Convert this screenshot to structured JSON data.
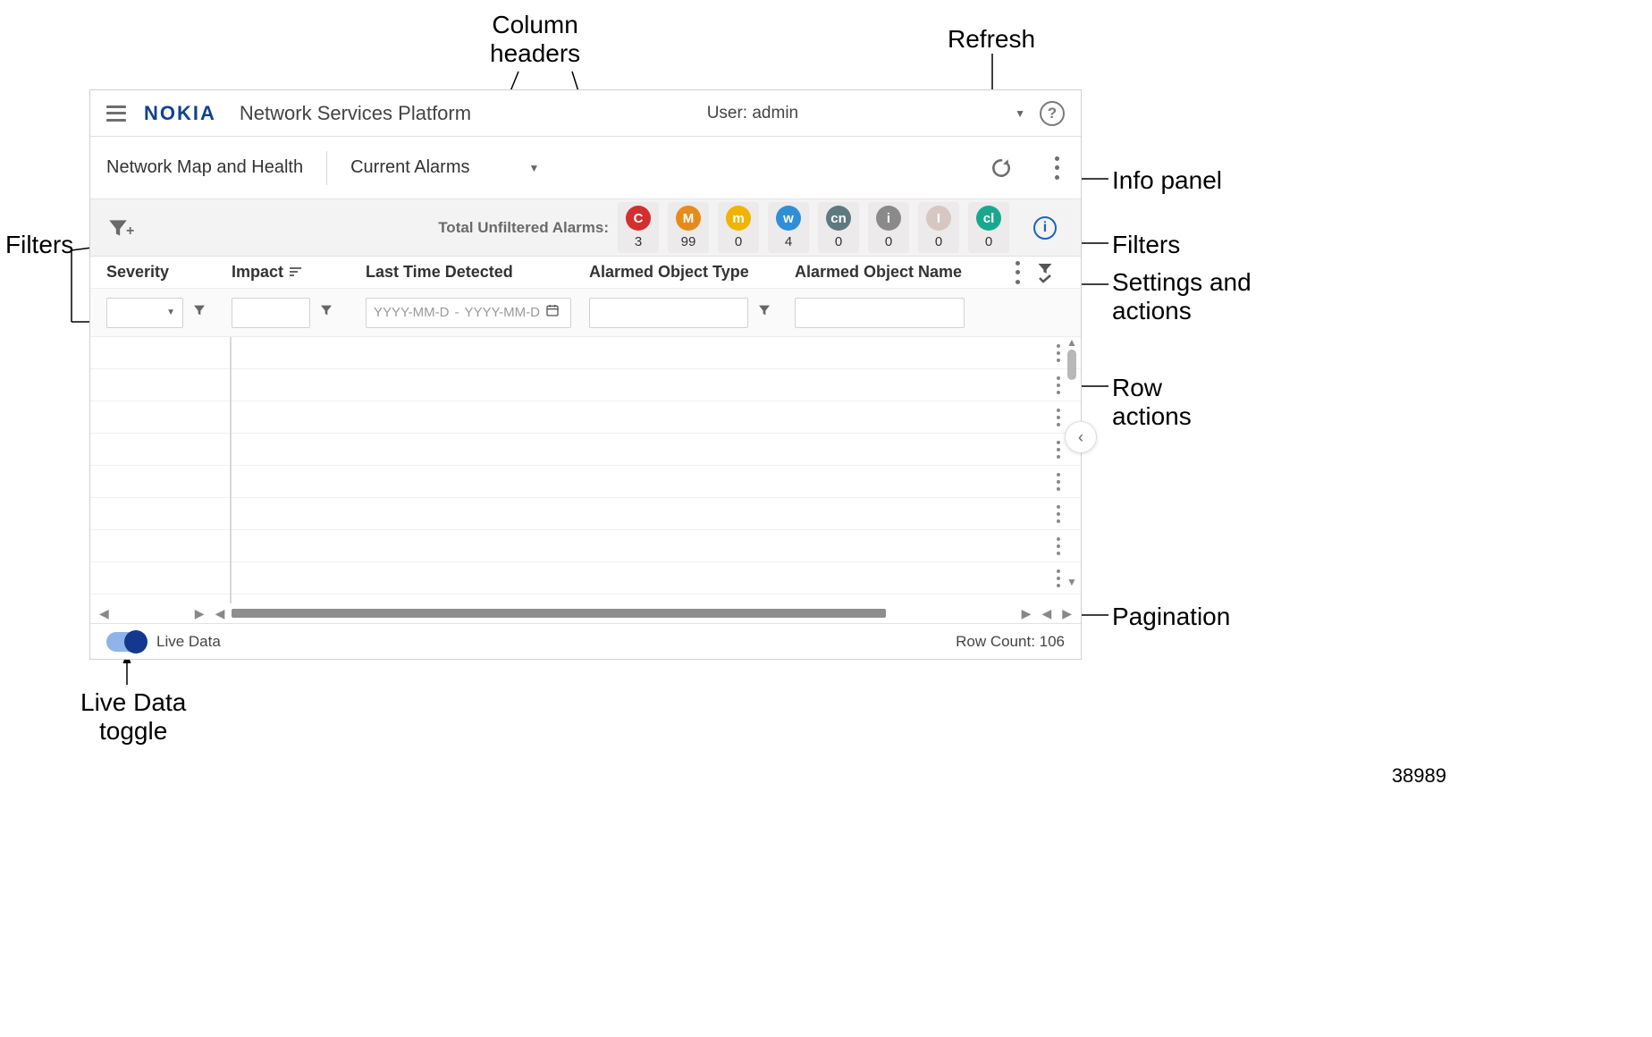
{
  "annotations": {
    "col_headers": "Column\nheaders",
    "refresh": "Refresh",
    "info_panel": "Info panel",
    "filters_left": "Filters",
    "filters_right": "Filters",
    "settings_actions": "Settings and\nactions",
    "row_actions": "Row\nactions",
    "pagination": "Pagination",
    "live_data_toggle": "Live Data\ntoggle",
    "image_id": "38989"
  },
  "header": {
    "brand": "NOKIA",
    "product": "Network Services Platform",
    "user_label": "User: admin"
  },
  "subnav": {
    "section": "Network Map and Health",
    "view": "Current Alarms"
  },
  "summary": {
    "total_label": "Total Unfiltered Alarms:",
    "chips": [
      {
        "code": "C",
        "color": "#d22f2f",
        "count": "3"
      },
      {
        "code": "M",
        "color": "#e88a1a",
        "count": "99"
      },
      {
        "code": "m",
        "color": "#f0b400",
        "count": "0"
      },
      {
        "code": "w",
        "color": "#2e8fd6",
        "count": "4"
      },
      {
        "code": "cn",
        "color": "#5e7a80",
        "count": "0"
      },
      {
        "code": "i",
        "color": "#8a8a8a",
        "count": "0"
      },
      {
        "code": "I",
        "color": "#d8c6c0",
        "count": "0"
      },
      {
        "code": "cl",
        "color": "#17a98f",
        "count": "0"
      }
    ]
  },
  "columns": {
    "severity": "Severity",
    "impact": "Impact",
    "last_time": "Last Time Detected",
    "obj_type": "Alarmed Object Type",
    "obj_name": "Alarmed Object Name"
  },
  "filters": {
    "date_placeholder_from": "YYYY-MM-D",
    "date_placeholder_to": "YYYY-MM-D",
    "date_sep": "-"
  },
  "footer": {
    "live_label": "Live Data",
    "row_count": "Row Count: 106"
  }
}
